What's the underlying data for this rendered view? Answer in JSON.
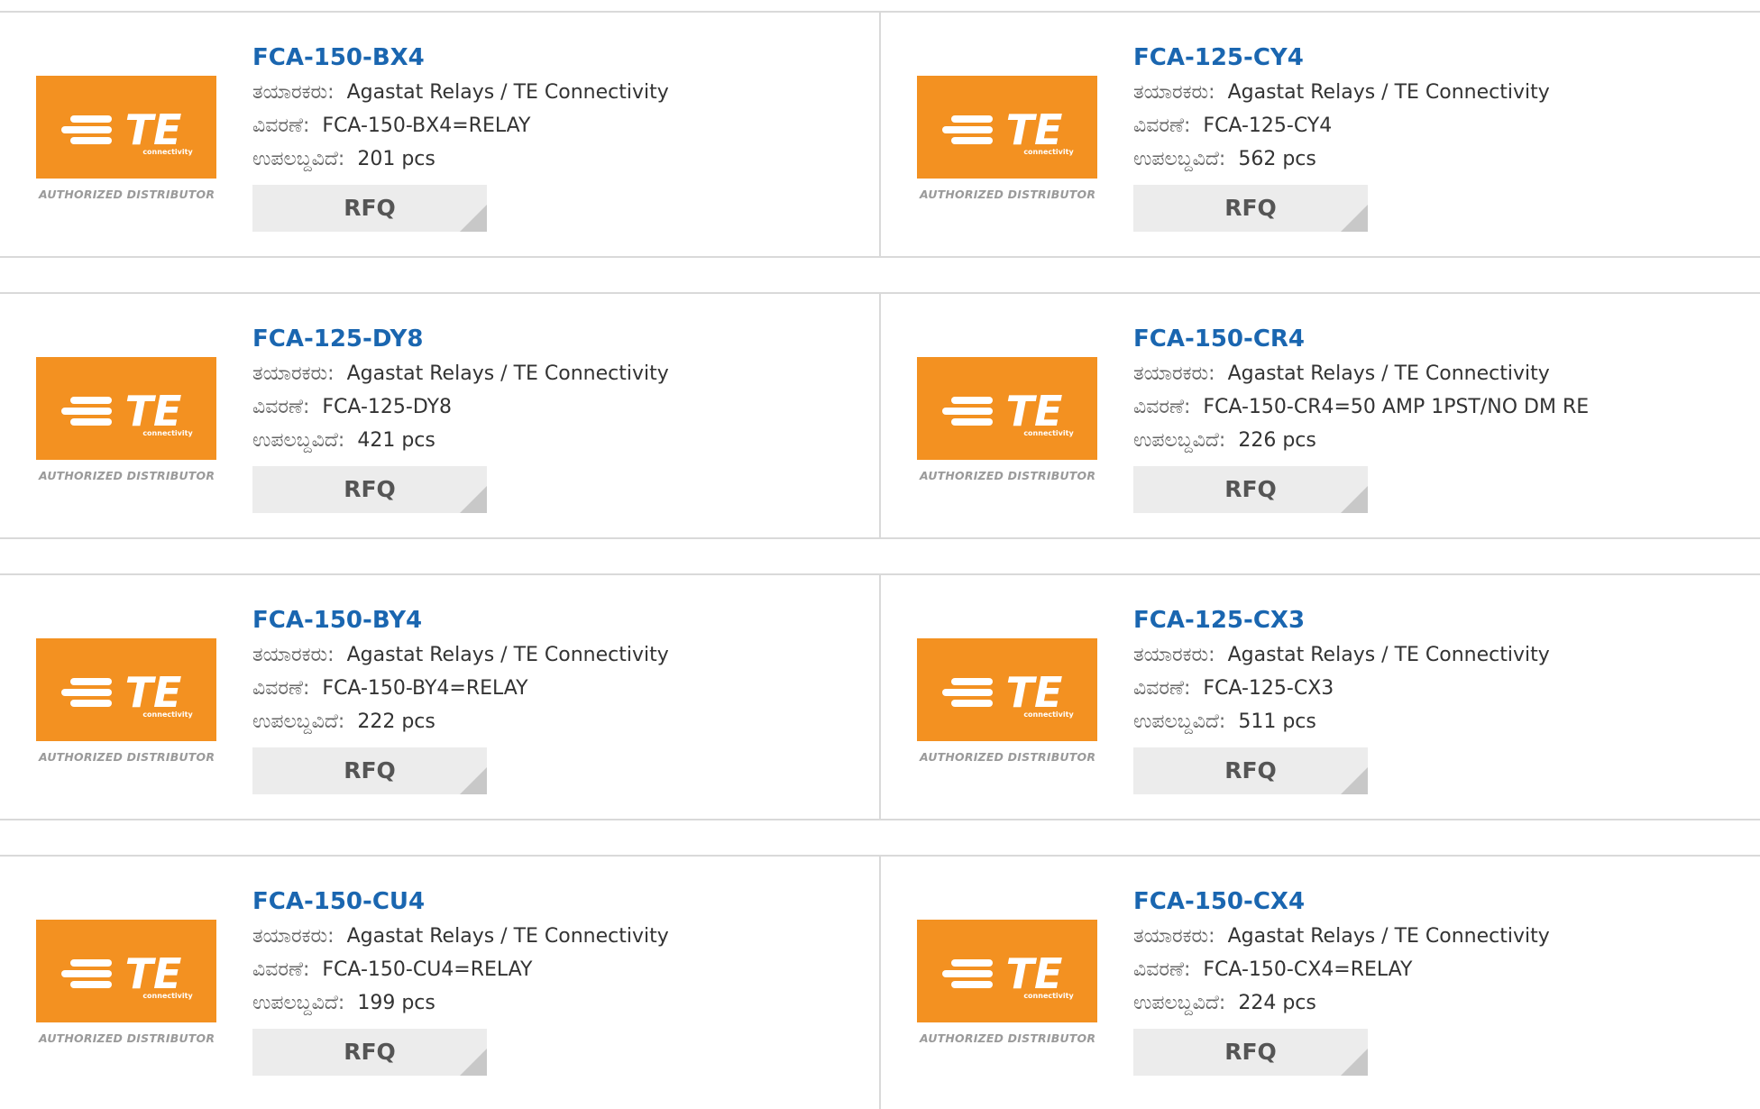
{
  "labels": {
    "manufacturer": "ತಯಾರಕರು:",
    "description": "ವಿವರಣೆ:",
    "available": "ಉಪಲಬ್ದವಿದೆ:"
  },
  "logo": {
    "brand": "TE",
    "sub": "connectivity",
    "caption": "AUTHORIZED DISTRIBUTOR",
    "color": "#f39121"
  },
  "rfq_label": "RFQ",
  "products": [
    {
      "part": "FCA-150-BX4",
      "manufacturer": "Agastat Relays / TE Connectivity",
      "description": "FCA-150-BX4=RELAY",
      "available": "201 pcs"
    },
    {
      "part": "FCA-125-CY4",
      "manufacturer": "Agastat Relays / TE Connectivity",
      "description": "FCA-125-CY4",
      "available": "562 pcs"
    },
    {
      "part": "FCA-125-DY8",
      "manufacturer": "Agastat Relays / TE Connectivity",
      "description": "FCA-125-DY8",
      "available": "421 pcs"
    },
    {
      "part": "FCA-150-CR4",
      "manufacturer": "Agastat Relays / TE Connectivity",
      "description": "FCA-150-CR4=50 AMP 1PST/NO DM RE",
      "available": "226 pcs"
    },
    {
      "part": "FCA-150-BY4",
      "manufacturer": "Agastat Relays / TE Connectivity",
      "description": "FCA-150-BY4=RELAY",
      "available": "222 pcs"
    },
    {
      "part": "FCA-125-CX3",
      "manufacturer": "Agastat Relays / TE Connectivity",
      "description": "FCA-125-CX3",
      "available": "511 pcs"
    },
    {
      "part": "FCA-150-CU4",
      "manufacturer": "Agastat Relays / TE Connectivity",
      "description": "FCA-150-CU4=RELAY",
      "available": "199 pcs"
    },
    {
      "part": "FCA-150-CX4",
      "manufacturer": "Agastat Relays / TE Connectivity",
      "description": "FCA-150-CX4=RELAY",
      "available": "224 pcs"
    }
  ]
}
